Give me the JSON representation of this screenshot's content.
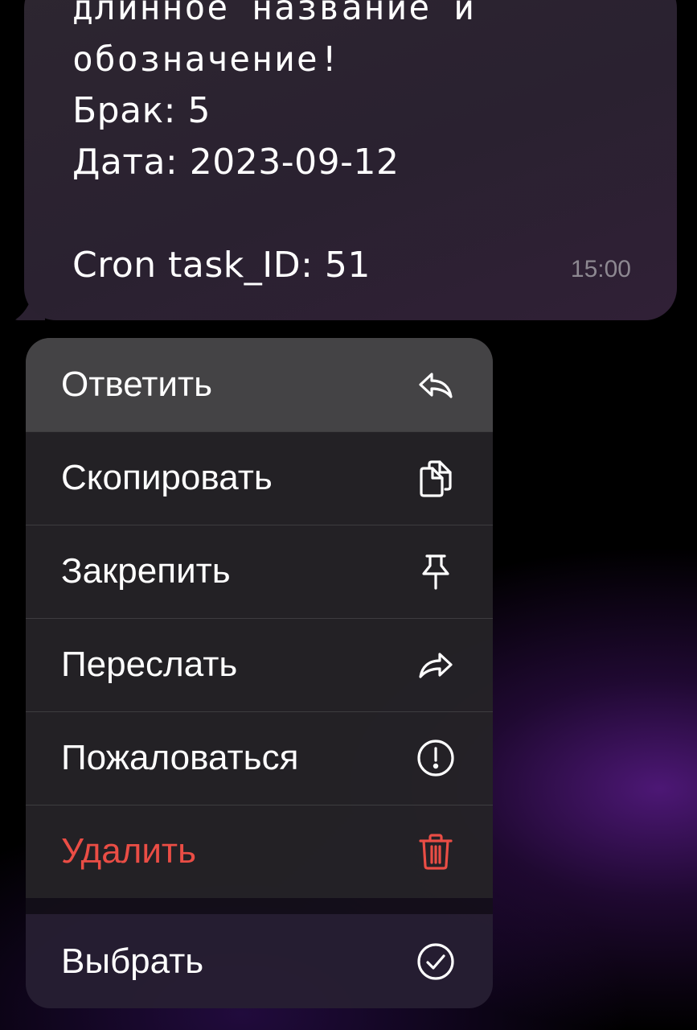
{
  "message": {
    "lines_mono": [
      "длинное название и",
      "обозначение!"
    ],
    "defect_line": "Брак: 5",
    "date_line": "Дата: 2023-09-12",
    "cron_line": "Cron task_ID: 51",
    "time": "15:00"
  },
  "menu": {
    "items": [
      {
        "label": "Ответить",
        "icon": "reply-icon"
      },
      {
        "label": "Скопировать",
        "icon": "copy-icon"
      },
      {
        "label": "Закрепить",
        "icon": "pin-icon"
      },
      {
        "label": "Переслать",
        "icon": "forward-icon"
      },
      {
        "label": "Пожаловаться",
        "icon": "report-icon"
      },
      {
        "label": "Удалить",
        "icon": "trash-icon"
      }
    ],
    "select": {
      "label": "Выбрать",
      "icon": "checkmark-circle-icon"
    }
  },
  "colors": {
    "destructive": "#ea4d45",
    "highlight": "#444345",
    "timestamp": "#8d8891"
  }
}
